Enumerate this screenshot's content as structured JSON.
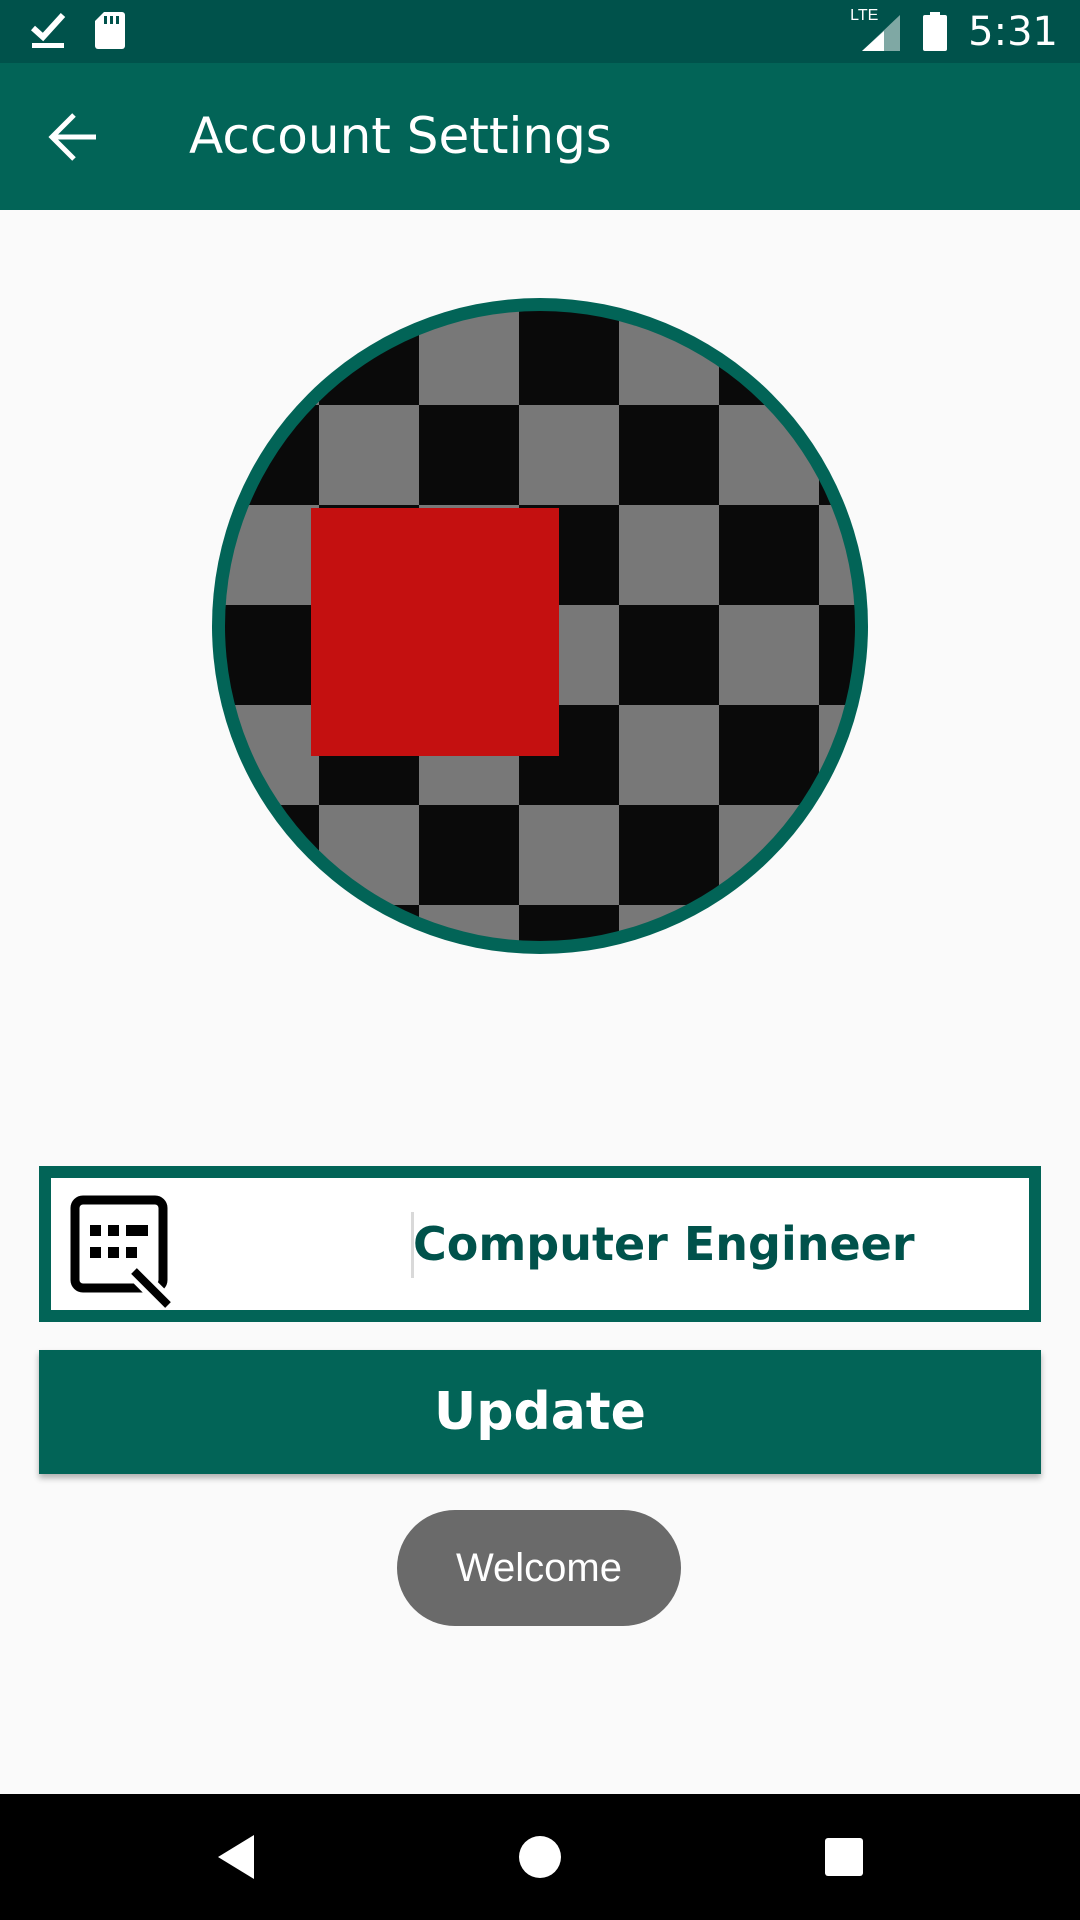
{
  "status_bar": {
    "time": "5:31",
    "network": "LTE",
    "icons": [
      "download-done-icon",
      "sd-card-icon",
      "signal-icon",
      "battery-icon"
    ]
  },
  "app_bar": {
    "title": "Account Settings",
    "back_icon": "arrow-back-icon"
  },
  "profile": {
    "image_colors": {
      "ring": "#026457",
      "checker_dark": "#0a0a0a",
      "checker_light": "#787878",
      "square": "#c41010"
    }
  },
  "name_field": {
    "value": "Computer Engineer",
    "icon": "edit-note-icon"
  },
  "update_button": {
    "label": "Update"
  },
  "toast": {
    "text": "Welcome"
  },
  "nav_bar": {
    "buttons": [
      "back-triangle-icon",
      "home-circle-icon",
      "recents-square-icon"
    ]
  },
  "colors": {
    "primary": "#026457",
    "primary_dark": "#00524b",
    "background": "#fafafa"
  }
}
